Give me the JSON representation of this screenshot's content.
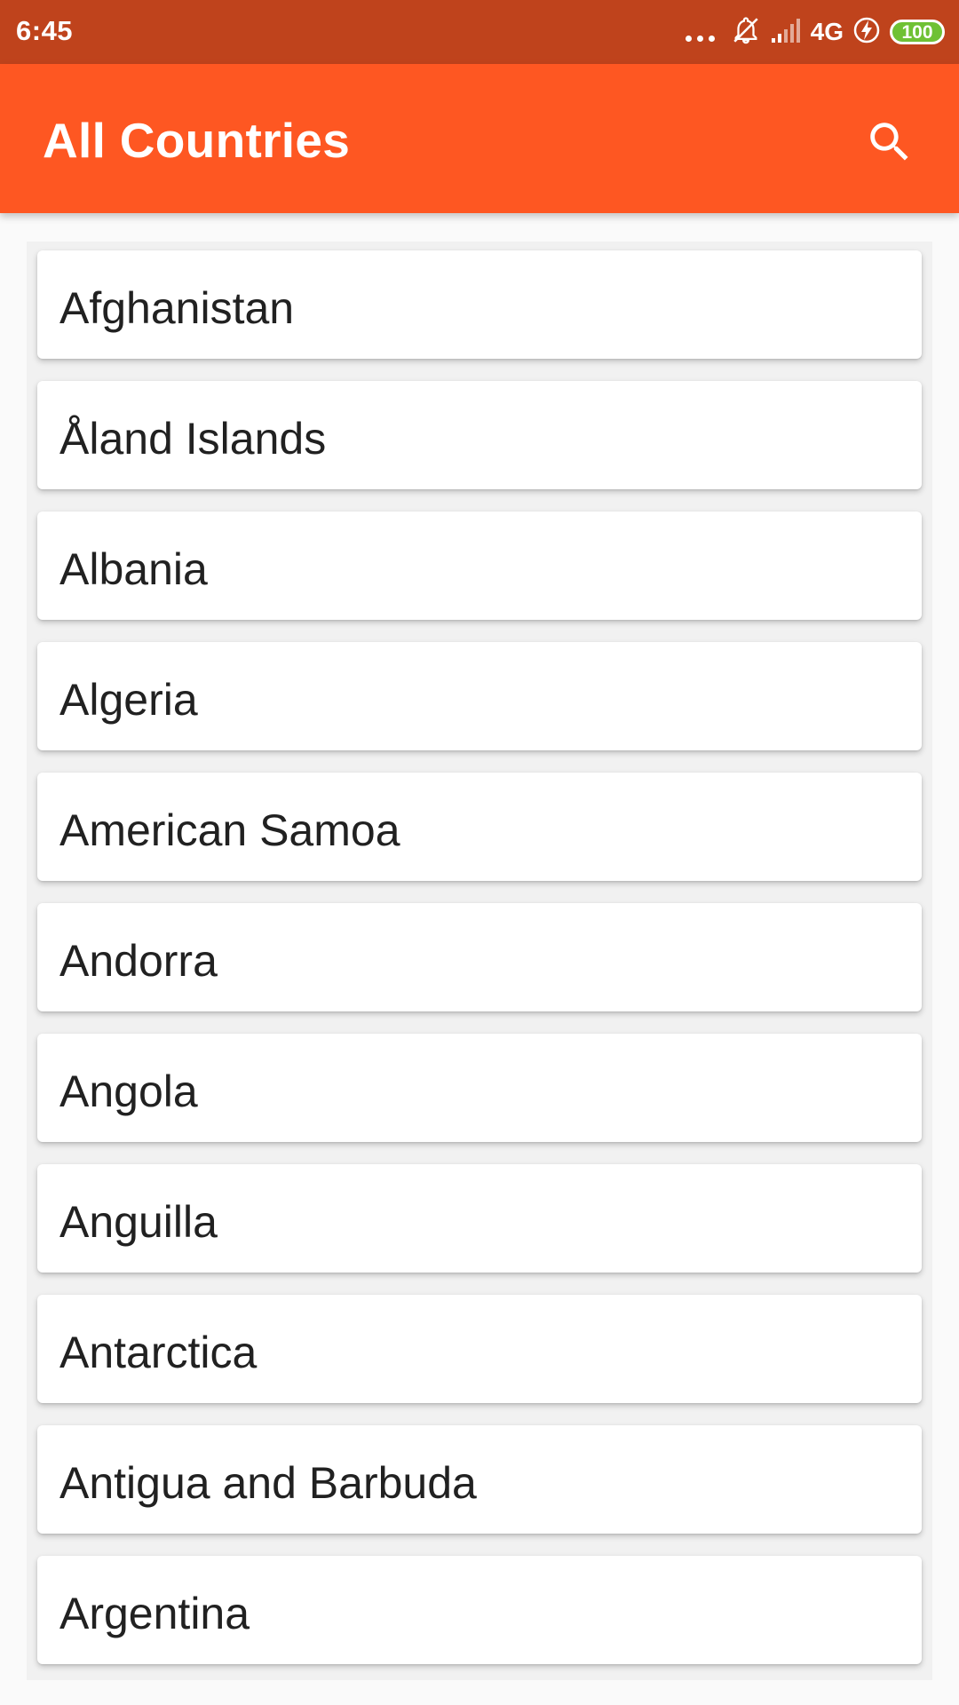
{
  "status_bar": {
    "time": "6:45",
    "network": "4G",
    "battery": "100",
    "icons": [
      "more-dots-icon",
      "mute-bell-icon",
      "signal-icon",
      "charging-icon",
      "battery-icon"
    ],
    "background_color": "#bf431c",
    "battery_color": "#6fc134"
  },
  "app_bar": {
    "title": "All Countries",
    "search_icon": "search-icon",
    "background_color": "#fe5722"
  },
  "countries": [
    {
      "name": "Afghanistan"
    },
    {
      "name": "Åland Islands"
    },
    {
      "name": "Albania"
    },
    {
      "name": "Algeria"
    },
    {
      "name": "American Samoa"
    },
    {
      "name": "Andorra"
    },
    {
      "name": "Angola"
    },
    {
      "name": "Anguilla"
    },
    {
      "name": "Antarctica"
    },
    {
      "name": "Antigua and Barbuda"
    },
    {
      "name": "Argentina"
    }
  ]
}
